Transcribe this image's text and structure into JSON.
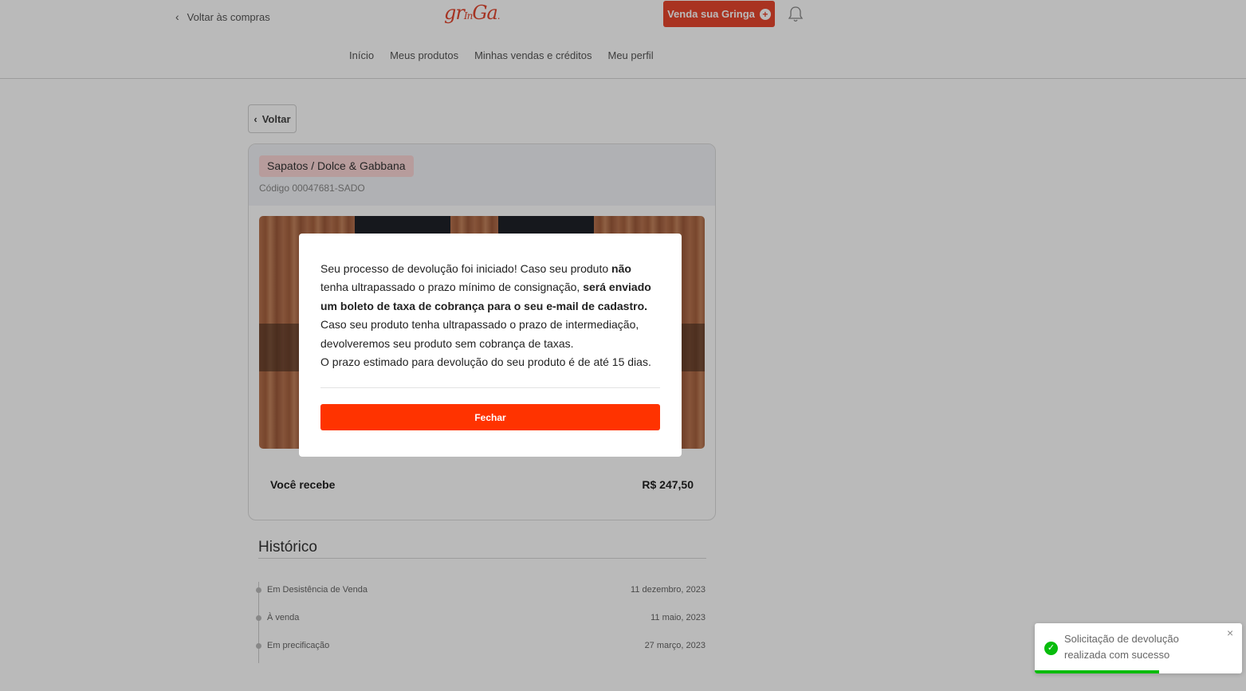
{
  "header": {
    "back_to_shop": "Voltar às compras",
    "logo_text": "grInGa",
    "sell_button": "Venda sua Gringa",
    "nav": [
      "Início",
      "Meus produtos",
      "Minhas vendas e créditos",
      "Meu perfil"
    ]
  },
  "main": {
    "back_button": "Voltar",
    "product": {
      "category_tag": "Sapatos / Dolce & Gabbana",
      "code": "Código 00047681-SADO",
      "receive_label": "Você recebe",
      "receive_value": "R$ 247,50"
    },
    "history": {
      "title": "Histórico",
      "items": [
        {
          "label": "Em Desistência de Venda",
          "date": "11 dezembro, 2023"
        },
        {
          "label": "À venda",
          "date": "11 maio, 2023"
        },
        {
          "label": "Em precificação",
          "date": "27 março, 2023"
        }
      ]
    }
  },
  "modal": {
    "p1_a": "Seu processo de devolução foi iniciado! Caso seu produto ",
    "p1_b": "não",
    "p1_c": " tenha ultrapassado o prazo mínimo de consignação, ",
    "p1_d": "será enviado um boleto de taxa de cobrança para o seu e-mail de cadastro.",
    "p1_e": " Caso seu produto tenha ultrapassado o prazo de intermediação, devolveremos seu produto sem cobrança de taxas.",
    "p2": "O prazo estimado para devolução do seu produto é de até 15 dias.",
    "close_button": "Fechar"
  },
  "toast": {
    "message": "Solicitação de devolução realizada com sucesso",
    "close": "×",
    "progress": 0.6
  },
  "colors": {
    "accent": "#e8462e",
    "modal_button": "#ff3300",
    "success": "#07bc0c",
    "tag_bg": "#fbd6d6"
  }
}
